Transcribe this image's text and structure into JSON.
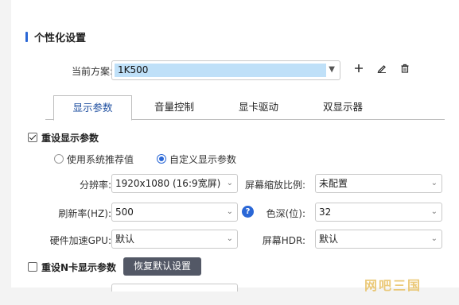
{
  "section": {
    "title": "个性化设置"
  },
  "scheme": {
    "label": "当前方案:",
    "value": "1K500"
  },
  "tabs": [
    {
      "label": "显示参数",
      "active": true
    },
    {
      "label": "音量控制",
      "active": false
    },
    {
      "label": "显卡驱动",
      "active": false
    },
    {
      "label": "双显示器",
      "active": false
    }
  ],
  "display": {
    "reset_label": "重设显示参数",
    "reset_checked": true,
    "radio_recommended": "使用系统推荐值",
    "radio_custom": "自定义显示参数",
    "resolution_label": "分辨率:",
    "resolution_value": "1920x1080 (16:9宽屏)",
    "scaling_label": "屏幕缩放比例:",
    "scaling_value": "未配置",
    "refresh_label": "刷新率(HZ):",
    "refresh_value": "500",
    "depth_label": "色深(位):",
    "depth_value": "32",
    "gpu_label": "硬件加速GPU:",
    "gpu_value": "默认",
    "hdr_label": "屏幕HDR:",
    "hdr_value": "默认"
  },
  "ncard": {
    "reset_label": "重设N卡显示参数",
    "reset_checked": false,
    "restore_button": "恢复默认设置"
  },
  "watermark": "网吧三国",
  "colors": {
    "accent": "#2a67d6",
    "selection": "#bfe0f8",
    "dark_button": "#535866"
  }
}
